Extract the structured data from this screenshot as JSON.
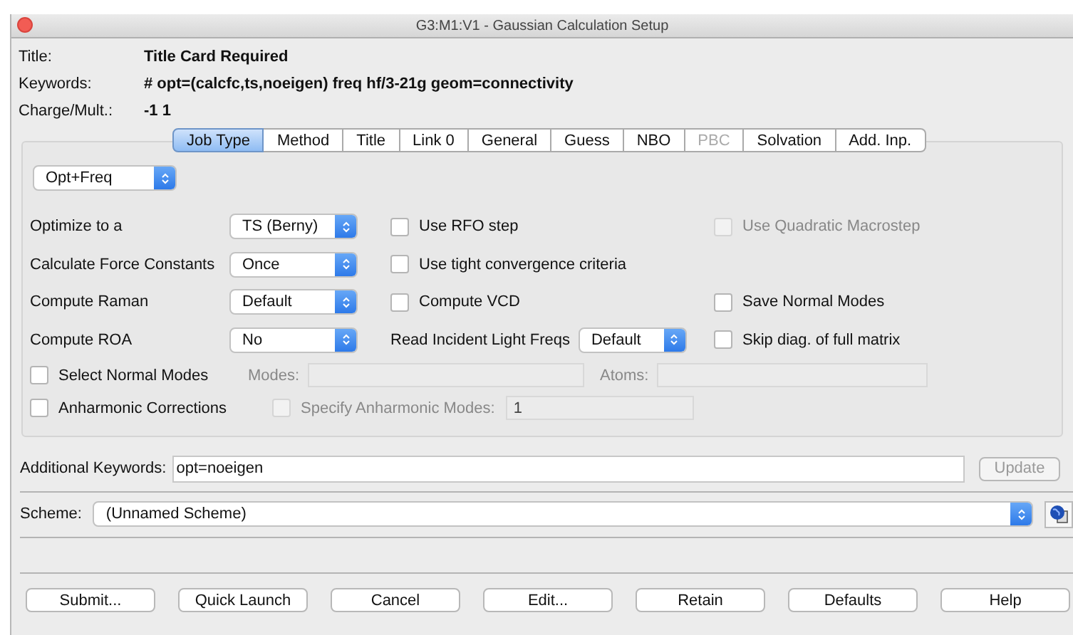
{
  "window": {
    "title": "G3:M1:V1 - Gaussian Calculation Setup"
  },
  "header": [
    {
      "label": "Title:",
      "value": "Title Card Required"
    },
    {
      "label": "Keywords:",
      "value": "# opt=(calcfc,ts,noeigen) freq hf/3-21g geom=connectivity"
    },
    {
      "label": "Charge/Mult.:",
      "value": "-1 1"
    }
  ],
  "tabs": [
    {
      "label": "Job Type",
      "selected": true,
      "disabled": false
    },
    {
      "label": "Method",
      "selected": false,
      "disabled": false
    },
    {
      "label": "Title",
      "selected": false,
      "disabled": false
    },
    {
      "label": "Link 0",
      "selected": false,
      "disabled": false
    },
    {
      "label": "General",
      "selected": false,
      "disabled": false
    },
    {
      "label": "Guess",
      "selected": false,
      "disabled": false
    },
    {
      "label": "NBO",
      "selected": false,
      "disabled": false
    },
    {
      "label": "PBC",
      "selected": false,
      "disabled": true
    },
    {
      "label": "Solvation",
      "selected": false,
      "disabled": false
    },
    {
      "label": "Add. Inp.",
      "selected": false,
      "disabled": false
    }
  ],
  "job_type": "Opt+Freq",
  "options": [
    {
      "cells": [
        {
          "kind": "select",
          "label": "Optimize to a",
          "value": "TS (Berny)"
        },
        {
          "kind": "checkbox",
          "label": "Use RFO step",
          "checked": false,
          "disabled": false
        },
        {
          "kind": "checkbox",
          "label": "Use Quadratic Macrostep",
          "checked": false,
          "disabled": true
        }
      ]
    },
    {
      "cells": [
        {
          "kind": "select",
          "label": "Calculate Force Constants",
          "value": "Once"
        },
        {
          "kind": "checkbox",
          "label": "Use tight convergence criteria",
          "checked": false,
          "disabled": false
        }
      ]
    },
    {
      "cells": [
        {
          "kind": "select",
          "label": "Compute Raman",
          "value": "Default"
        },
        {
          "kind": "checkbox",
          "label": "Compute VCD",
          "checked": false,
          "disabled": false
        },
        {
          "kind": "checkbox",
          "label": "Save Normal Modes",
          "checked": false,
          "disabled": false
        }
      ]
    },
    {
      "cells": [
        {
          "kind": "select",
          "label": "Compute ROA",
          "value": "No"
        },
        {
          "kind": "select",
          "label": "Read Incident Light Freqs",
          "value": "Default"
        },
        {
          "kind": "checkbox",
          "label": "Skip diag. of full matrix",
          "checked": false,
          "disabled": false
        }
      ]
    },
    {
      "cells": [
        {
          "kind": "checkbox",
          "label": "Select Normal Modes",
          "checked": false,
          "disabled": false
        },
        {
          "kind": "text_field",
          "label": "Modes:",
          "disabled": true
        },
        {
          "kind": "text_field",
          "label": "Atoms:",
          "disabled": true
        }
      ]
    },
    {
      "cells": [
        {
          "kind": "checkbox",
          "label": "Anharmonic Corrections",
          "checked": false,
          "disabled": false
        },
        {
          "kind": "checkbox_field",
          "label": "Specify Anharmonic Modes:",
          "checked": false,
          "disabled": true,
          "value": "1"
        }
      ]
    }
  ],
  "additional_keywords": {
    "label": "Additional Keywords:",
    "value": "opt=noeigen",
    "update_button": {
      "label": "Update",
      "disabled": true
    }
  },
  "scheme": {
    "label": "Scheme:",
    "value": "(Unnamed Scheme)"
  },
  "buttons": [
    "Submit...",
    "Quick Launch",
    "Cancel",
    "Edit...",
    "Retain",
    "Defaults",
    "Help"
  ]
}
